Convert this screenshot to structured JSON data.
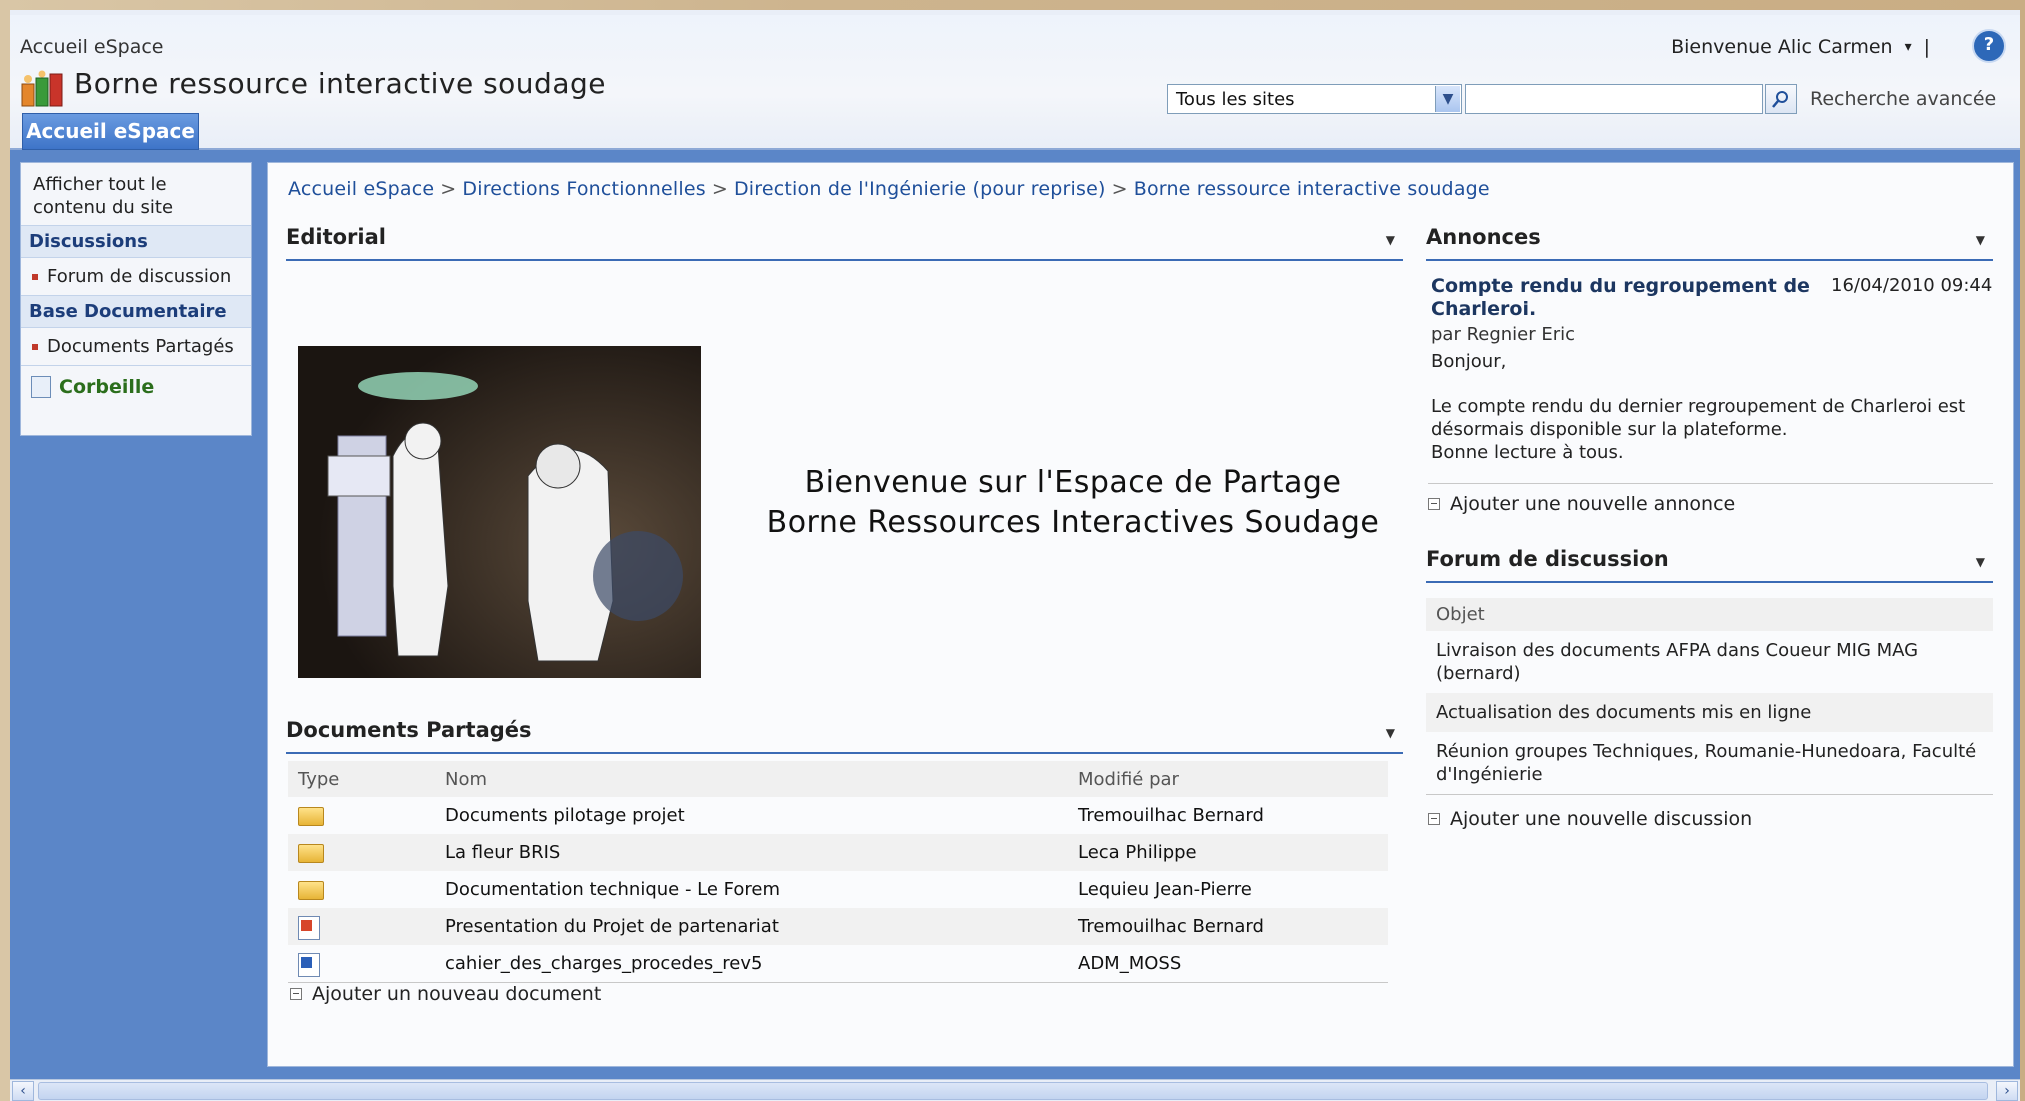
{
  "header": {
    "top_breadcrumb": "Accueil eSpace",
    "welcome": "Bienvenue Alic Carmen",
    "welcome_arrow": "▾",
    "separator": "|",
    "help_glyph": "?",
    "site_title": "Borne ressource interactive soudage",
    "home_tab": "Accueil eSpace",
    "search_scope": "Tous les sites",
    "search_value": "",
    "advanced_search": "Recherche avancée"
  },
  "leftnav": {
    "view_all": "Afficher tout le contenu du site",
    "sections": [
      {
        "heading": "Discussions",
        "items": [
          "Forum de discussion"
        ]
      },
      {
        "heading": "Base Documentaire",
        "items": [
          "Documents Partagés"
        ]
      }
    ],
    "recycle_bin": "Corbeille"
  },
  "breadcrumb": [
    "Accueil eSpace",
    "Directions Fonctionnelles",
    "Direction de l'Ingénierie (pour reprise)",
    "Borne ressource interactive soudage"
  ],
  "breadcrumb_sep": ">",
  "editorial": {
    "title": "Editorial",
    "welcome_line1": "Bienvenue sur l'Espace de Partage",
    "welcome_line2": "Borne Ressources Interactives Soudage"
  },
  "documents": {
    "title": "Documents Partagés",
    "columns": [
      "Type",
      "Nom",
      "Modifié par"
    ],
    "rows": [
      {
        "type": "folder-icon",
        "name": "Documents pilotage projet",
        "modified_by": "Tremouilhac Bernard"
      },
      {
        "type": "folder-icon",
        "name": "La fleur BRIS",
        "modified_by": "Leca Philippe"
      },
      {
        "type": "folder-icon",
        "name": "Documentation technique - Le Forem",
        "modified_by": "Lequieu Jean-Pierre"
      },
      {
        "type": "powerpoint-icon",
        "name": "Presentation du Projet de partenariat",
        "modified_by": "Tremouilhac Bernard"
      },
      {
        "type": "word-icon",
        "name": "cahier_des_charges_procedes_rev5",
        "modified_by": "ADM_MOSS"
      }
    ],
    "add_link": "Ajouter un nouveau document"
  },
  "announcements": {
    "title": "Annonces",
    "item": {
      "title": "Compte rendu du regroupement de Charleroi.",
      "date": "16/04/2010 09:44",
      "author": "par Regnier Eric",
      "greeting": "Bonjour,",
      "body1": "Le compte rendu du dernier regroupement de Charleroi est désormais disponible sur la plateforme.",
      "body2": "Bonne lecture à tous."
    },
    "add_link": "Ajouter une nouvelle annonce"
  },
  "forum": {
    "title": "Forum de discussion",
    "column": "Objet",
    "rows": [
      "Livraison des documents AFPA dans Coueur MIG MAG (bernard)",
      "Actualisation des documents mis en ligne",
      "Réunion groupes Techniques, Roumanie-Hunedoara, Faculté d'Ingénierie"
    ],
    "add_link": "Ajouter une nouvelle discussion"
  },
  "scrollbar": {
    "left": "‹",
    "right": "›"
  },
  "colors": {
    "accent": "#3e74c8",
    "frame": "#5b86c8",
    "link": "#1f4f9a"
  }
}
